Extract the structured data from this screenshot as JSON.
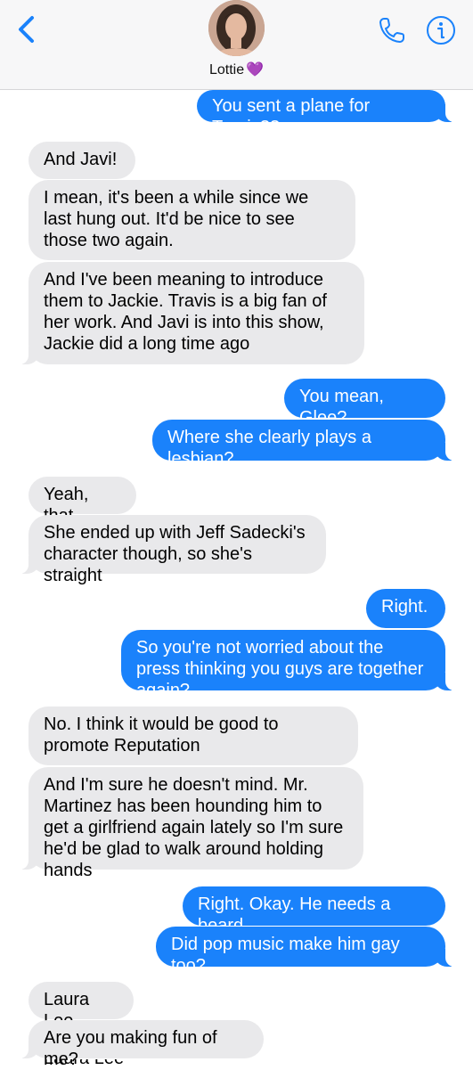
{
  "header": {
    "contact_name": "Lottie",
    "contact_emoji": "💜",
    "icons": {
      "back": "chevron-left-icon",
      "call": "phone-icon",
      "info": "info-icon"
    },
    "accent_color": "#1a82fb"
  },
  "messages": [
    {
      "side": "out",
      "text": "You sent a plane for Travis??"
    },
    {
      "side": "in",
      "text": "And Javi!"
    },
    {
      "side": "in",
      "text": "I mean, it's been a while since we last hung out. It'd be nice to see those two again."
    },
    {
      "side": "in",
      "text": "And I've been meaning to introduce them to Jackie. Travis is a big fan of her work. And Javi is into this show, Jackie did a long time ago"
    },
    {
      "side": "out",
      "text": "You mean, Glee?"
    },
    {
      "side": "out",
      "text": "Where she clearly plays a lesbian?"
    },
    {
      "side": "in",
      "text": "Yeah, that"
    },
    {
      "side": "in",
      "text": "She ended up with Jeff Sadecki's character though, so she's straight"
    },
    {
      "side": "out",
      "text": "Right."
    },
    {
      "side": "out",
      "text": "So you're not worried about the press thinking you guys are together again?"
    },
    {
      "side": "in",
      "text": "No. I think it would be good to promote Reputation"
    },
    {
      "side": "in",
      "text": "And I'm sure he doesn't mind. Mr. Martinez has been hounding him to get a girlfriend again lately so I'm sure he'd be glad to walk around holding hands"
    },
    {
      "side": "out",
      "text": "Right. Okay. He needs a beard"
    },
    {
      "side": "out",
      "text": "Did pop music make him gay too?"
    },
    {
      "side": "in",
      "text": "Laura Lee"
    },
    {
      "side": "in",
      "text": "Are you making fun of me?"
    },
    {
      "side": "in",
      "text": "Laura Lee"
    }
  ],
  "colors": {
    "incoming_bubble": "#e9e9eb",
    "outgoing_bubble": "#1a82fb"
  }
}
